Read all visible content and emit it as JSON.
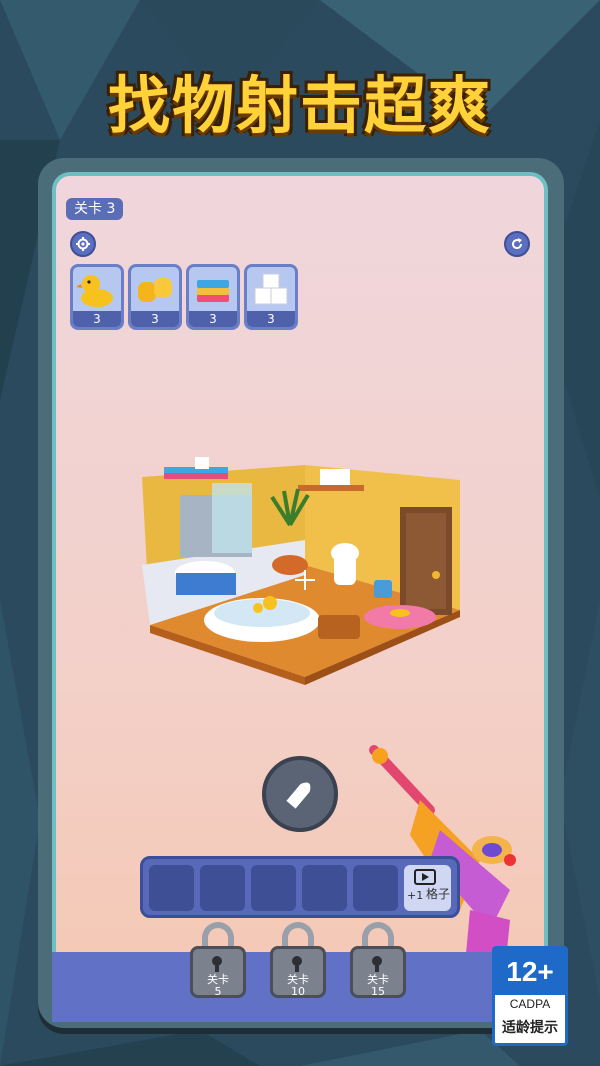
{
  "title": "找物射击超爽",
  "level": {
    "label": "关卡 3"
  },
  "targets": [
    {
      "icon": "rubber-duck-icon",
      "count": "3"
    },
    {
      "icon": "soap-bars-icon",
      "count": "3"
    },
    {
      "icon": "towel-stack-icon",
      "count": "3"
    },
    {
      "icon": "toilet-paper-icon",
      "count": "3"
    }
  ],
  "slots": {
    "ad_plus": "+1",
    "ad_text": "格子"
  },
  "locks": [
    {
      "label": "关卡",
      "num": "5"
    },
    {
      "label": "关卡",
      "num": "10"
    },
    {
      "label": "关卡",
      "num": "15"
    }
  ],
  "age_rating": {
    "age": "12+",
    "org": "CADPA",
    "note": "适龄提示"
  },
  "colors": {
    "title": "#ffd23a",
    "panel": "#5769b8",
    "frame": "#6dbfc4"
  }
}
